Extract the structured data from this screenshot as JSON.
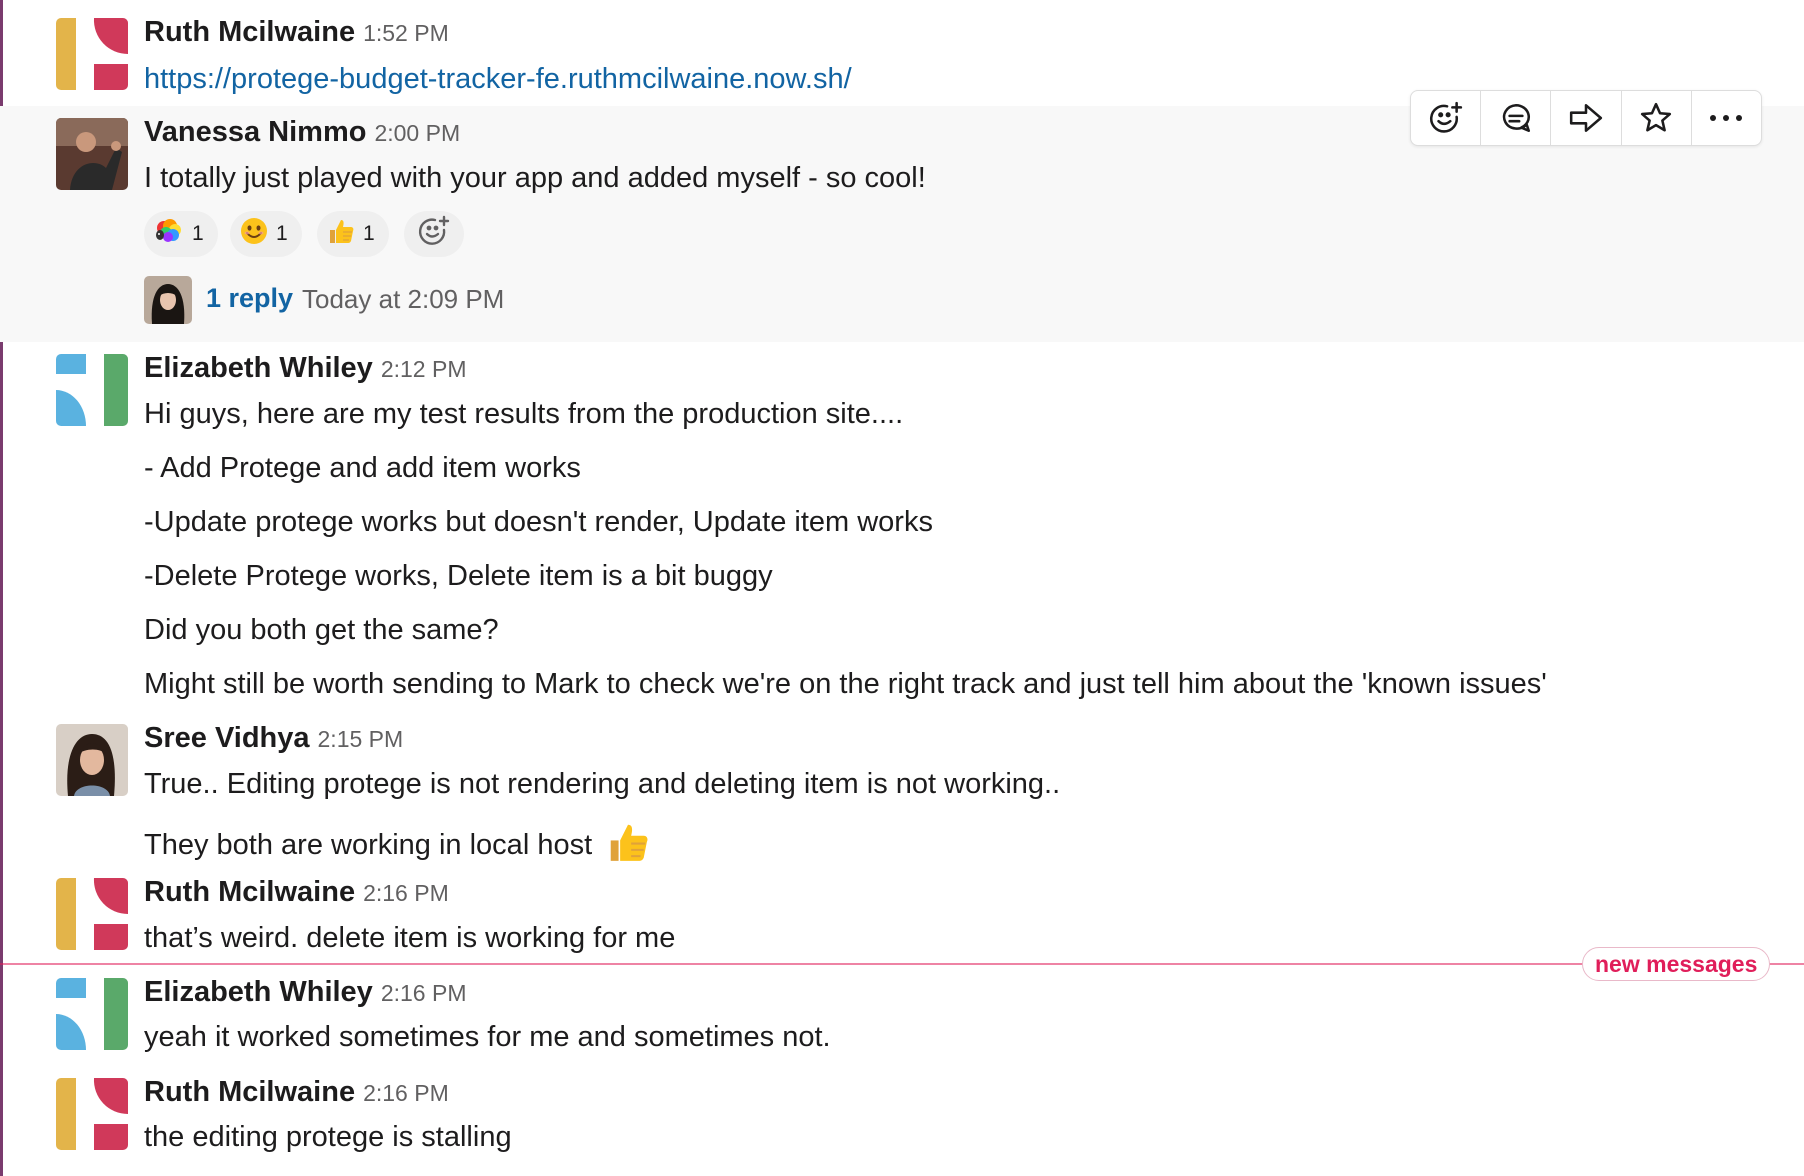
{
  "messages": [
    {
      "author": "Ruth Mcilwaine",
      "time": "1:52 PM",
      "lines": [
        "https://protege-budget-tracker-fe.ruthmcilwaine.now.sh/"
      ]
    },
    {
      "author": "Vanessa Nimmo",
      "time": "2:00 PM",
      "lines": [
        "I totally just played with your app and added myself - so cool!"
      ]
    },
    {
      "author": "Elizabeth Whiley",
      "time": "2:12 PM",
      "lines": [
        "Hi guys, here are my test results from the production site....",
        "- Add Protege and add item works",
        "-Update protege works but doesn't render, Update item works",
        "-Delete Protege works, Delete item is a bit buggy",
        "Did you both get the same?",
        "Might still be worth sending to Mark to check we're on the right track and just tell him about the 'known issues'"
      ]
    },
    {
      "author": "Sree Vidhya",
      "time": "2:15 PM",
      "lines": [
        "True.. Editing protege is not rendering and deleting item is not working..",
        "They both are working in local host"
      ]
    },
    {
      "author": "Ruth Mcilwaine",
      "time": "2:16 PM",
      "lines": [
        "that’s weird. delete item is working for me"
      ]
    },
    {
      "author": "Elizabeth Whiley",
      "time": "2:16 PM",
      "lines": [
        "yeah it worked sometimes for me and sometimes not."
      ]
    },
    {
      "author": "Ruth Mcilwaine",
      "time": "2:16 PM",
      "lines": [
        "the editing protege is stalling"
      ]
    }
  ],
  "reactions": [
    {
      "emoji": "rainbow-sheep",
      "count": "1"
    },
    {
      "emoji": "smile",
      "count": "1"
    },
    {
      "emoji": "thumbsup",
      "count": "1"
    }
  ],
  "thread": {
    "reply_label": "1 reply",
    "time": "Today at 2:09 PM"
  },
  "divider_label": "new messages",
  "toolbar": [
    "add-reaction",
    "reply-in-thread",
    "share",
    "save",
    "more-actions"
  ],
  "colors": {
    "link": "#1264a3",
    "new_messages": "#e01e5a",
    "ruth_yellow": "#e3b44a",
    "ruth_red": "#d0395a",
    "liz_blue": "#5ab2e0",
    "liz_green": "#5aa96a"
  }
}
